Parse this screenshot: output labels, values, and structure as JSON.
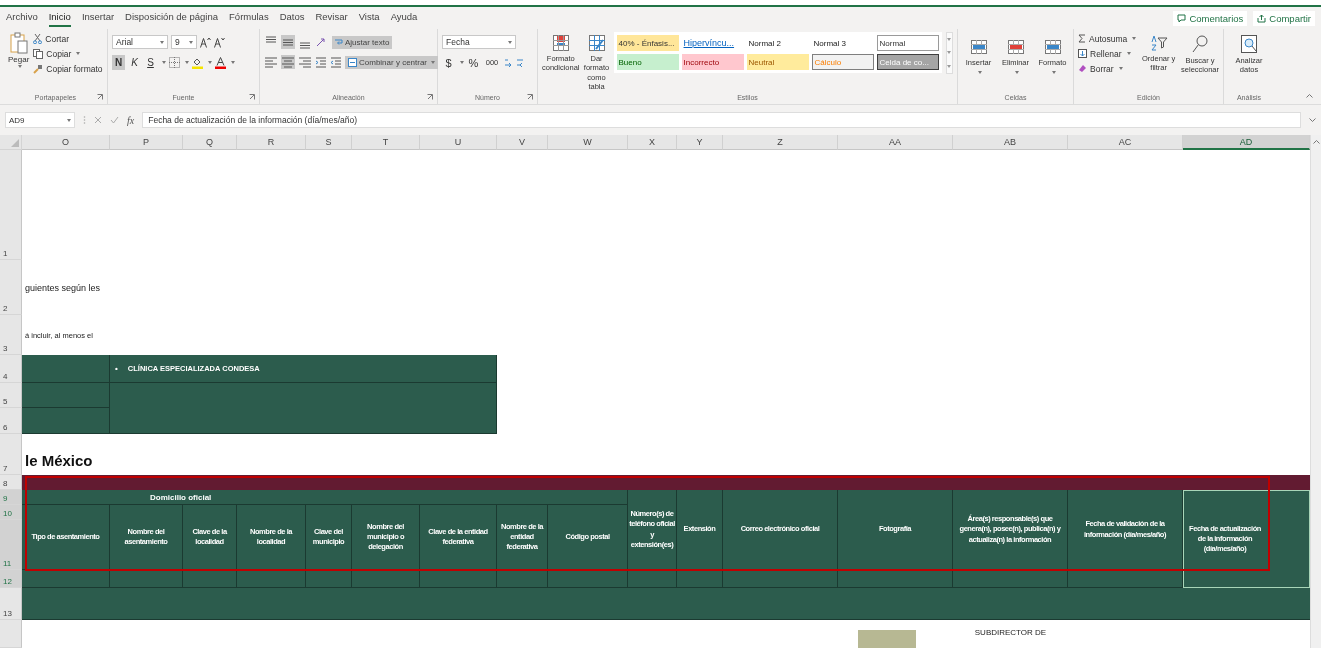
{
  "menu_tabs": [
    {
      "label": "Archivo",
      "selected": false
    },
    {
      "label": "Inicio",
      "selected": true
    },
    {
      "label": "Insertar",
      "selected": false
    },
    {
      "label": "Disposición de página",
      "selected": false
    },
    {
      "label": "Fórmulas",
      "selected": false
    },
    {
      "label": "Datos",
      "selected": false
    },
    {
      "label": "Revisar",
      "selected": false
    },
    {
      "label": "Vista",
      "selected": false
    },
    {
      "label": "Ayuda",
      "selected": false
    }
  ],
  "top_actions": [
    {
      "label": "Comentarios",
      "kind": "comments"
    },
    {
      "label": "Compartir",
      "kind": "share"
    }
  ],
  "ribbon": {
    "clipboard": {
      "paste": "Pegar",
      "cut": "Cortar",
      "copy": "Copiar",
      "format_painter": "Copiar formato",
      "label": "Portapapeles"
    },
    "font": {
      "name": "Arial",
      "size": "9",
      "bold": {
        "label": "N",
        "on": true
      },
      "italic": {
        "label": "K",
        "on": false
      },
      "underline": {
        "label": "S",
        "on": false
      },
      "label": "Fuente"
    },
    "alignment": {
      "vertical": [
        {
          "kind": "top",
          "on": false
        },
        {
          "kind": "middle",
          "on": true
        },
        {
          "kind": "bottom",
          "on": false
        }
      ],
      "horizontal": [
        {
          "kind": "left",
          "on": false
        },
        {
          "kind": "center",
          "on": true
        },
        {
          "kind": "right",
          "on": false
        }
      ],
      "wrap": {
        "label": "Ajustar texto",
        "on": true
      },
      "merge": {
        "label": "Combinar y centrar",
        "on": true
      },
      "label": "Alineación"
    },
    "number": {
      "format": "Fecha",
      "currency": "$",
      "percent": "%",
      "thousands": "000",
      "label": "Número"
    },
    "styles": {
      "conditional": "Formato condicional",
      "as_table": "Dar formato como tabla",
      "label": "Estilos",
      "gallery": [
        {
          "label": "40% - Énfasis...",
          "kind": "accent"
        },
        {
          "label": "Hipervíncu...",
          "kind": "link"
        },
        {
          "label": "Normal 2",
          "kind": "plain"
        },
        {
          "label": "Normal 3",
          "kind": "plain"
        },
        {
          "label": "Normal",
          "kind": "boxed"
        },
        {
          "label": "Bueno",
          "kind": "good"
        },
        {
          "label": "Incorrecto",
          "kind": "bad"
        },
        {
          "label": "Neutral",
          "kind": "neutral"
        },
        {
          "label": "Cálculo",
          "kind": "calc"
        },
        {
          "label": "Celda de co...",
          "kind": "check"
        }
      ]
    },
    "cells": {
      "label": "Celdas",
      "buttons": [
        {
          "label": "Insertar",
          "kind": "insert"
        },
        {
          "label": "Eliminar",
          "kind": "delete"
        },
        {
          "label": "Formato",
          "kind": "format"
        }
      ]
    },
    "editing": {
      "autosum": "Autosuma",
      "fill": "Rellenar",
      "clear": "Borrar",
      "sort": "Ordenar y filtrar",
      "find": "Buscar y seleccionar",
      "label": "Edición"
    },
    "analysis": {
      "analyze": "Analizar datos",
      "label": "Análisis"
    }
  },
  "formula_bar": {
    "name_box": "AD9",
    "fx": "fx",
    "formula": "Fecha de actualización de la información (día/mes/año)"
  },
  "column_headers": [
    {
      "label": "O",
      "selected": false
    },
    {
      "label": "P",
      "selected": false
    },
    {
      "label": "Q",
      "selected": false
    },
    {
      "label": "R",
      "selected": false
    },
    {
      "label": "S",
      "selected": false
    },
    {
      "label": "T",
      "selected": false
    },
    {
      "label": "U",
      "selected": false
    },
    {
      "label": "V",
      "selected": false
    },
    {
      "label": "W",
      "selected": false
    },
    {
      "label": "X",
      "selected": false
    },
    {
      "label": "Y",
      "selected": false
    },
    {
      "label": "Z",
      "selected": false
    },
    {
      "label": "AA",
      "selected": false
    },
    {
      "label": "AB",
      "selected": false
    },
    {
      "label": "AC",
      "selected": false
    },
    {
      "label": "AD",
      "selected": true
    }
  ],
  "row_numbers": [
    {
      "label": "1",
      "selected": false
    },
    {
      "label": "2",
      "selected": false
    },
    {
      "label": "3",
      "selected": false
    },
    {
      "label": "4",
      "selected": false
    },
    {
      "label": "5",
      "selected": false
    },
    {
      "label": "6",
      "selected": false
    },
    {
      "label": "7",
      "selected": false
    },
    {
      "label": "8",
      "selected": false
    },
    {
      "label": "9",
      "selected": true
    },
    {
      "label": "10",
      "selected": true
    },
    {
      "label": "11",
      "selected": true
    },
    {
      "label": "12",
      "selected": true
    },
    {
      "label": "13",
      "selected": false
    }
  ],
  "sheet": {
    "fragments": [
      "guientes según les",
      "á incluir, al menos el"
    ],
    "clinic": {
      "bullet": "•",
      "name": "CLÍNICA ESPECIALIZADA CONDESA"
    },
    "heading": "le México",
    "table": {
      "group_label": "Domicilio oficial",
      "group_columns": [
        {
          "label": "Tipo de asentamiento",
          "selected": false
        },
        {
          "label": "Nombre del asentamiento",
          "selected": false
        },
        {
          "label": "Clave de la localidad",
          "selected": false
        },
        {
          "label": "Nombre de la localidad",
          "selected": false
        },
        {
          "label": "Clave del municipio",
          "selected": false
        },
        {
          "label": "Nombre del municipio o delegación",
          "selected": false
        },
        {
          "label": "Clave de la entidad federativa",
          "selected": false
        },
        {
          "label": "Nombre de la entidad federativa",
          "selected": false
        },
        {
          "label": "Código postal",
          "selected": false
        }
      ],
      "other_columns": [
        {
          "label": "Número(s) de teléfono oficial y extensión(es)",
          "selected": false
        },
        {
          "label": "Extensión",
          "selected": false
        },
        {
          "label": "Correo electrónico oficial",
          "selected": false
        },
        {
          "label": "Fotografía",
          "selected": false
        },
        {
          "label": "Área(s) responsable(s) que genera(n), posee(n), publica(n) y actualiza(n) la información",
          "selected": false
        },
        {
          "label": "Fecha de validación de la información (día/mes/año)",
          "selected": false
        },
        {
          "label": "Fecha de actualización de la información (día/mes/año)",
          "selected": true
        }
      ]
    },
    "signature": {
      "title": "SUBDIRECTOR DE"
    }
  }
}
